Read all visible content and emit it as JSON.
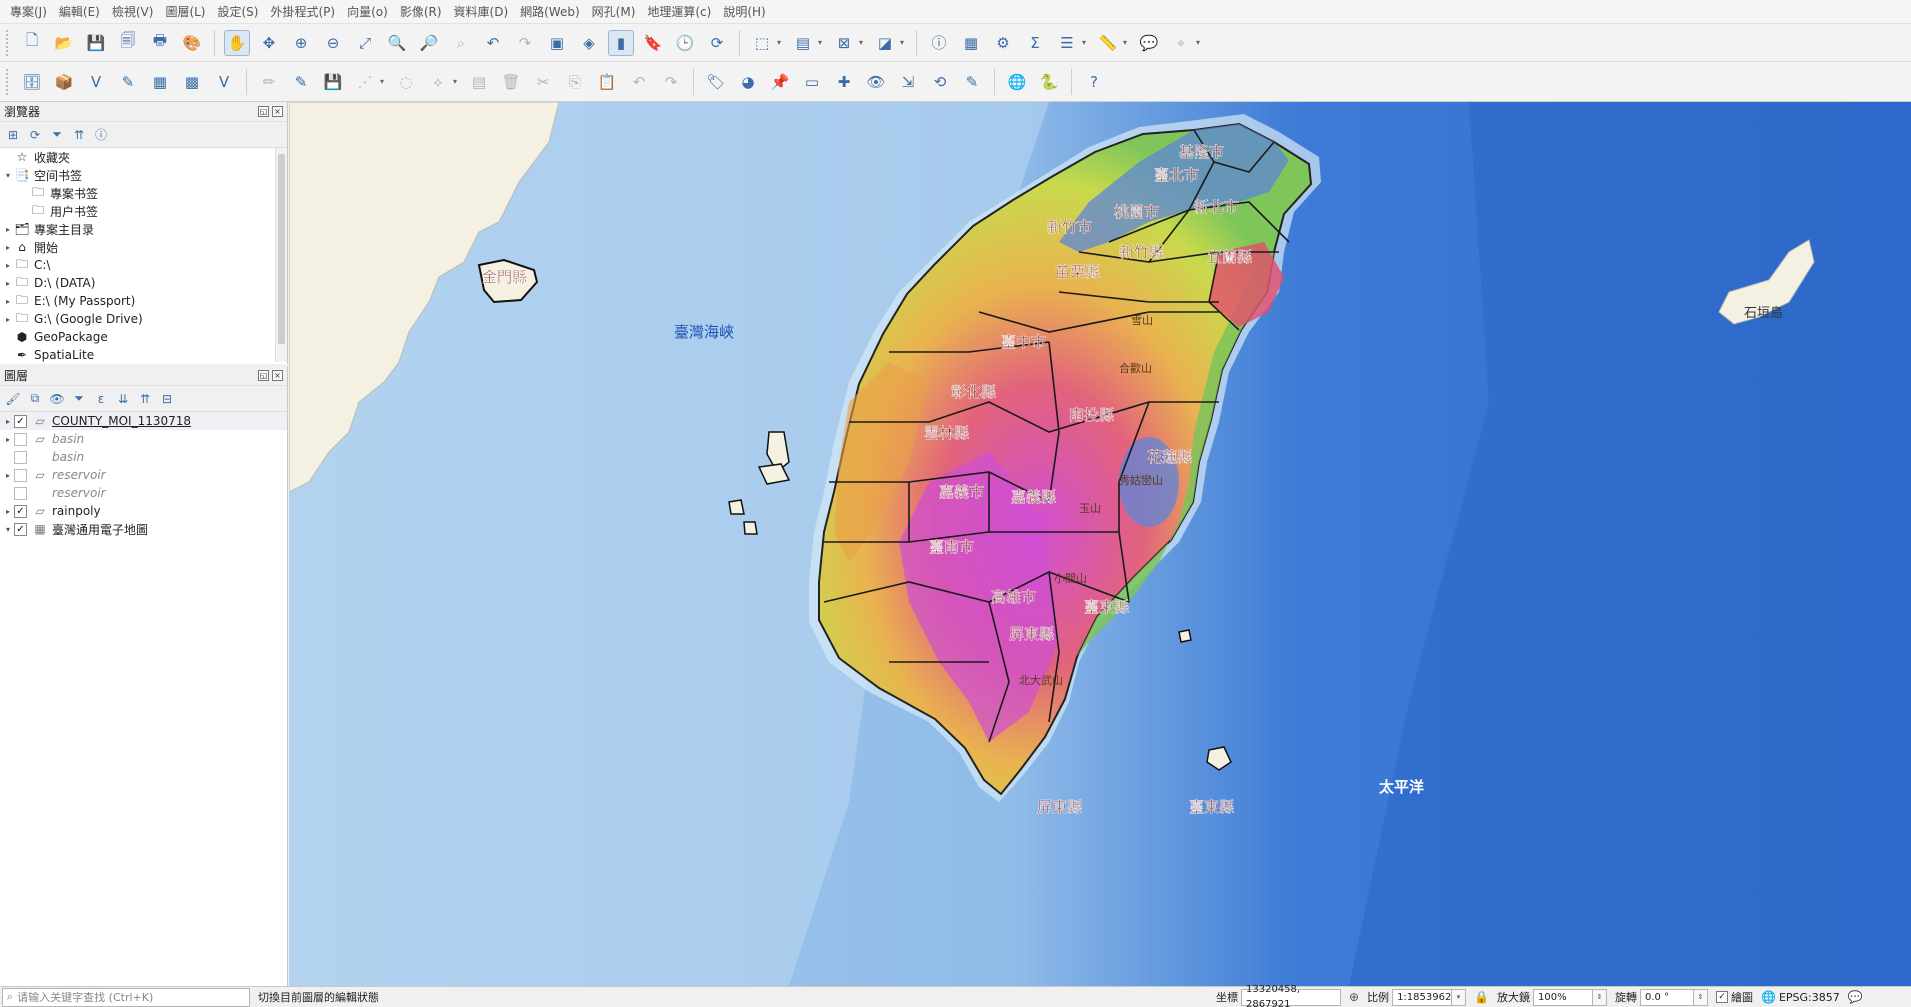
{
  "menubar": {
    "items": [
      "專案(J)",
      "編輯(E)",
      "檢視(V)",
      "圖層(L)",
      "設定(S)",
      "外掛程式(P)",
      "向量(o)",
      "影像(R)",
      "資料庫(D)",
      "網路(Web)",
      "网孔(M)",
      "地理運算(c)",
      "說明(H)"
    ]
  },
  "toolbar1": {
    "buttons": [
      {
        "icon": "new-project-icon",
        "glyph": "🗋"
      },
      {
        "icon": "open-project-icon",
        "glyph": "📂"
      },
      {
        "icon": "save-project-icon",
        "glyph": "💾"
      },
      {
        "icon": "save-as-icon",
        "glyph": "🗐"
      },
      {
        "icon": "print-layout-icon",
        "glyph": "🖶"
      },
      {
        "icon": "style-manager-icon",
        "glyph": "🎨"
      },
      {
        "sep": true
      },
      {
        "icon": "pan-icon",
        "glyph": "✋",
        "active": true
      },
      {
        "icon": "pan-to-selection-icon",
        "glyph": "✥"
      },
      {
        "icon": "zoom-in-icon",
        "glyph": "⊕"
      },
      {
        "icon": "zoom-out-icon",
        "glyph": "⊖"
      },
      {
        "icon": "zoom-full-icon",
        "glyph": "⤢"
      },
      {
        "icon": "zoom-selection-icon",
        "glyph": "🔍"
      },
      {
        "icon": "zoom-layer-icon",
        "glyph": "🔎"
      },
      {
        "icon": "zoom-native-icon",
        "glyph": "⌕",
        "dim": true
      },
      {
        "icon": "zoom-last-icon",
        "glyph": "↶"
      },
      {
        "icon": "zoom-next-icon",
        "glyph": "↷",
        "dim": true
      },
      {
        "icon": "new-map-view-icon",
        "glyph": "▣"
      },
      {
        "icon": "new-3d-view-icon",
        "glyph": "◈"
      },
      {
        "icon": "temporal-icon",
        "glyph": "▮",
        "active": true
      },
      {
        "icon": "bookmark-icon",
        "glyph": "🔖"
      },
      {
        "icon": "clock-icon",
        "glyph": "🕒"
      },
      {
        "icon": "refresh-icon",
        "glyph": "⟳"
      },
      {
        "sep": true
      },
      {
        "icon": "select-features-icon",
        "glyph": "⬚"
      },
      {
        "arrow": true
      },
      {
        "icon": "select-by-value-icon",
        "glyph": "▤"
      },
      {
        "arrow": true
      },
      {
        "icon": "deselect-icon",
        "glyph": "⊠"
      },
      {
        "arrow": true
      },
      {
        "icon": "select-location-icon",
        "glyph": "◪"
      },
      {
        "arrow": true
      },
      {
        "sep": true
      },
      {
        "icon": "identify-icon",
        "glyph": "ⓘ"
      },
      {
        "icon": "attribute-table-icon",
        "glyph": "▦"
      },
      {
        "icon": "processing-icon",
        "glyph": "⚙"
      },
      {
        "icon": "statistics-icon",
        "glyph": "Σ"
      },
      {
        "icon": "open-table-icon",
        "glyph": "☰"
      },
      {
        "arrow": true
      },
      {
        "icon": "measure-icon",
        "glyph": "📏"
      },
      {
        "arrow": true
      },
      {
        "icon": "map-tips-icon",
        "glyph": "💬"
      },
      {
        "icon": "locator-icon",
        "glyph": "⌖",
        "dim": true
      },
      {
        "arrow": true
      }
    ]
  },
  "toolbar2": {
    "buttons": [
      {
        "icon": "data-source-manager-icon",
        "glyph": "🗄"
      },
      {
        "icon": "new-geopackage-icon",
        "glyph": "📦"
      },
      {
        "icon": "add-vector-icon",
        "glyph": "V"
      },
      {
        "icon": "add-line-icon",
        "glyph": "✎"
      },
      {
        "icon": "add-raster-icon",
        "glyph": "▦"
      },
      {
        "icon": "add-mesh-icon",
        "glyph": "▩"
      },
      {
        "icon": "add-virtual-layer-icon",
        "glyph": "V"
      },
      {
        "sep": true
      },
      {
        "icon": "current-edits-icon",
        "glyph": "✏",
        "dim": true
      },
      {
        "icon": "toggle-editing-icon",
        "glyph": "✎"
      },
      {
        "icon": "save-edits-icon",
        "glyph": "💾",
        "dim": true
      },
      {
        "icon": "digitize-icon",
        "glyph": "⋰",
        "dim": true
      },
      {
        "arrow": true
      },
      {
        "icon": "add-feature-icon",
        "glyph": "◌",
        "dim": true
      },
      {
        "icon": "vertex-tool-icon",
        "glyph": "⟡",
        "dim": true
      },
      {
        "arrow": true
      },
      {
        "icon": "modify-attributes-icon",
        "glyph": "▤",
        "dim": true
      },
      {
        "icon": "delete-selected-icon",
        "glyph": "🗑",
        "dim": true
      },
      {
        "icon": "cut-features-icon",
        "glyph": "✂",
        "dim": true
      },
      {
        "icon": "copy-features-icon",
        "glyph": "⎘",
        "dim": true
      },
      {
        "icon": "paste-features-icon",
        "glyph": "📋",
        "dim": true
      },
      {
        "icon": "undo-icon",
        "glyph": "↶",
        "dim": true
      },
      {
        "icon": "redo-icon",
        "glyph": "↷",
        "dim": true
      },
      {
        "sep": true
      },
      {
        "icon": "label-tool-icon",
        "glyph": "🏷"
      },
      {
        "icon": "diagram-tool-icon",
        "glyph": "◕"
      },
      {
        "icon": "pin-labels-icon",
        "glyph": "📌"
      },
      {
        "icon": "highlight-labels-icon",
        "glyph": "▭"
      },
      {
        "icon": "move-label-icon",
        "glyph": "✚"
      },
      {
        "icon": "show-hide-labels-icon",
        "glyph": "👁"
      },
      {
        "icon": "move-label-2-icon",
        "glyph": "⇲"
      },
      {
        "icon": "rotate-label-icon",
        "glyph": "⟲"
      },
      {
        "icon": "change-label-icon",
        "glyph": "✎"
      },
      {
        "sep": true
      },
      {
        "icon": "plugin-globe-icon",
        "glyph": "🌐"
      },
      {
        "icon": "python-console-icon",
        "glyph": "🐍"
      },
      {
        "sep": true
      },
      {
        "icon": "help-icon",
        "glyph": "?"
      }
    ]
  },
  "browser_panel": {
    "title": "瀏覽器",
    "tools": [
      "add-layer-icon",
      "refresh-icon",
      "filter-icon",
      "collapse-all-icon",
      "info-icon"
    ],
    "items": [
      {
        "label": "收藏夾",
        "icon": "☆",
        "iconName": "favorites-star-icon",
        "level": 0,
        "expander": ""
      },
      {
        "label": "空间书签",
        "icon": "📑",
        "iconName": "spatial-bookmarks-icon",
        "level": 0,
        "expander": "▾"
      },
      {
        "label": "專案书签",
        "icon": "🗀",
        "iconName": "folder-icon",
        "level": 1,
        "expander": ""
      },
      {
        "label": "用户书签",
        "icon": "🗀",
        "iconName": "folder-icon",
        "level": 1,
        "expander": ""
      },
      {
        "label": "專案主目录",
        "icon": "🗂",
        "iconName": "project-home-icon",
        "level": 0,
        "expander": "▸"
      },
      {
        "label": "開始",
        "icon": "⌂",
        "iconName": "home-icon",
        "level": 0,
        "expander": "▸"
      },
      {
        "label": "C:\\",
        "icon": "🗀",
        "iconName": "drive-icon",
        "level": 0,
        "expander": "▸"
      },
      {
        "label": "D:\\ (DATA)",
        "icon": "🗀",
        "iconName": "drive-icon",
        "level": 0,
        "expander": "▸"
      },
      {
        "label": "E:\\ (My Passport)",
        "icon": "🗀",
        "iconName": "drive-icon",
        "level": 0,
        "expander": "▸"
      },
      {
        "label": "G:\\ (Google Drive)",
        "icon": "🗀",
        "iconName": "drive-icon",
        "level": 0,
        "expander": "▸"
      },
      {
        "label": "GeoPackage",
        "icon": "⬢",
        "iconName": "geopackage-icon",
        "level": 0,
        "expander": ""
      },
      {
        "label": "SpatiaLite",
        "icon": "✒",
        "iconName": "spatialite-icon",
        "level": 0,
        "expander": ""
      }
    ]
  },
  "layers_panel": {
    "title": "圖層",
    "tools": [
      "style-icon",
      "add-group-icon",
      "visibility-icon",
      "filter-legend-icon",
      "expression-filter-icon",
      "expand-all-icon",
      "collapse-all-icon",
      "remove-layer-icon"
    ],
    "layers": [
      {
        "name": "COUNTY_MOI_1130718",
        "checked": true,
        "italic": false,
        "selected": true,
        "expander": "▸",
        "icon": "▱",
        "iconName": "polygon-layer-icon"
      },
      {
        "name": "basin",
        "checked": false,
        "italic": true,
        "selected": false,
        "expander": "▸",
        "icon": "▱",
        "iconName": "polygon-layer-icon"
      },
      {
        "name": "basin",
        "checked": false,
        "italic": true,
        "selected": false,
        "expander": "",
        "icon": "",
        "iconName": "none"
      },
      {
        "name": "reservoir",
        "checked": false,
        "italic": true,
        "selected": false,
        "expander": "▸",
        "icon": "▱",
        "iconName": "polygon-layer-icon"
      },
      {
        "name": "reservoir",
        "checked": false,
        "italic": true,
        "selected": false,
        "expander": "",
        "icon": "",
        "iconName": "none"
      },
      {
        "name": "rainpoly",
        "checked": true,
        "italic": false,
        "selected": false,
        "expander": "▸",
        "icon": "▱",
        "iconName": "polygon-layer-icon"
      },
      {
        "name": "臺灣通用電子地圖",
        "checked": true,
        "italic": false,
        "selected": false,
        "expander": "▾",
        "icon": "▦",
        "iconName": "raster-layer-icon"
      }
    ]
  },
  "map": {
    "county_labels": [
      "基隆市",
      "臺北市",
      "新北市",
      "桃園市",
      "新竹市",
      "新竹縣",
      "苗栗縣",
      "宜蘭縣",
      "臺中市",
      "彰化縣",
      "南投縣",
      "雲林縣",
      "花蓮縣",
      "嘉義市",
      "嘉義縣",
      "臺南市",
      "高雄市",
      "臺東縣",
      "屏東縣",
      "金門縣",
      "屏東縣",
      "臺東縣"
    ],
    "mountain_labels": [
      "雪山",
      "合歡山",
      "秀姑巒山",
      "玉山",
      "小關山",
      "北大武山"
    ],
    "sea_labels": [
      "臺灣海峽",
      "太平洋",
      "石垣島"
    ]
  },
  "statusbar": {
    "search_placeholder": "请输入关键字查找 (Ctrl+K)",
    "message": "切換目前圖層的編輯狀態",
    "coord_label": "坐標",
    "coord_value": "13320458, 2867921",
    "scale_label": "比例",
    "scale_value": "1:1853962",
    "magnifier_label": "放大鏡",
    "magnifier_value": "100%",
    "rotation_label": "旋轉",
    "rotation_value": "0.0 °",
    "render_label": "繪圖",
    "crs": "EPSG:3857"
  }
}
